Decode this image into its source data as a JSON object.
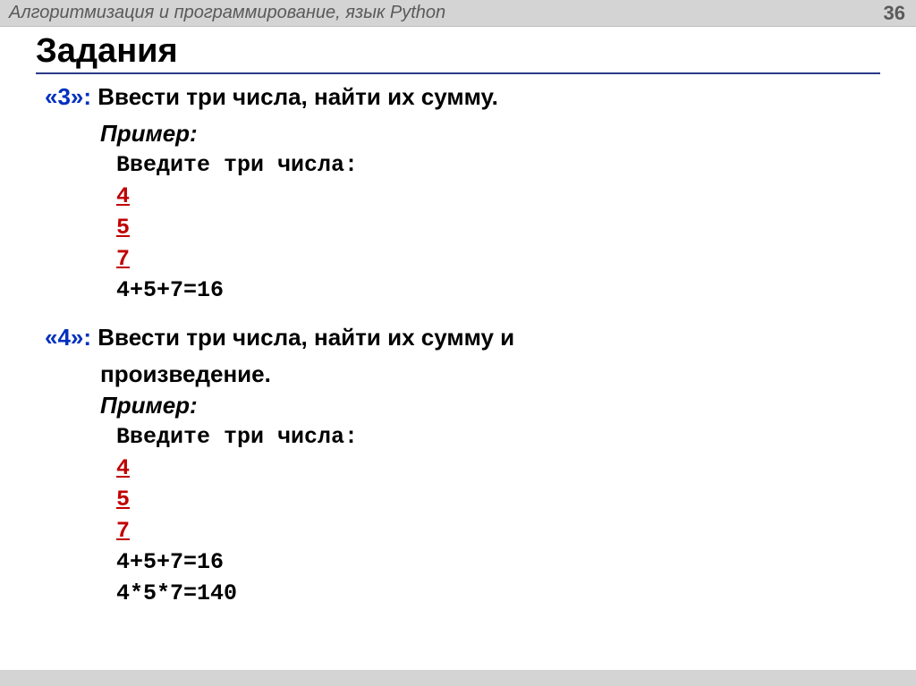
{
  "header": {
    "title": "Алгоритмизация и программирование, язык Python",
    "page": "36"
  },
  "mainTitle": "Задания",
  "tasks": [
    {
      "num": "«3»:",
      "desc": "Ввести три числа, найти их сумму.",
      "exampleLabel": "Пример:",
      "code": {
        "prompt": "Введите три числа:",
        "inputs": [
          "4",
          "5",
          "7"
        ],
        "outputs": [
          "4+5+7=16"
        ]
      }
    },
    {
      "num": "«4»:",
      "desc": "Ввести три числа, найти их сумму и",
      "descCont": "произведение.",
      "exampleLabel": "Пример:",
      "code": {
        "prompt": "Введите три числа:",
        "inputs": [
          "4",
          "5",
          "7"
        ],
        "outputs": [
          "4+5+7=16",
          "4*5*7=140"
        ]
      }
    }
  ]
}
